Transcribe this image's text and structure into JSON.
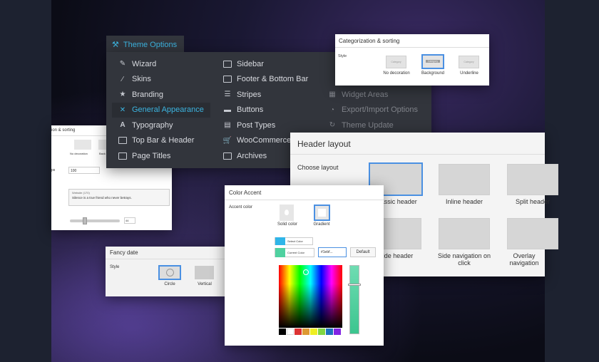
{
  "theme_menu": {
    "tab_label": "Theme Options",
    "col1": [
      {
        "label": "Wizard",
        "icon": "wand-icon"
      },
      {
        "label": "Skins",
        "icon": "brush-icon"
      },
      {
        "label": "Branding",
        "icon": "star-icon"
      },
      {
        "label": "General Appearance",
        "icon": "tools-icon",
        "active": true
      },
      {
        "label": "Typography",
        "icon": "font-icon"
      },
      {
        "label": "Top Bar & Header",
        "icon": "header-layout-icon"
      },
      {
        "label": "Page Titles",
        "icon": "page-icon"
      }
    ],
    "col2": [
      {
        "label": "Sidebar",
        "icon": "sidebar-icon"
      },
      {
        "label": "Footer & Bottom Bar",
        "icon": "footer-icon"
      },
      {
        "label": "Stripes",
        "icon": "stripes-icon"
      },
      {
        "label": "Buttons",
        "icon": "button-icon"
      },
      {
        "label": "Post Types",
        "icon": "post-types-icon"
      },
      {
        "label": "WooCommerce",
        "icon": "cart-icon"
      },
      {
        "label": "Archives",
        "icon": "archive-icon"
      }
    ],
    "col3": [
      {
        "label": "Widget Areas",
        "icon": "widgets-icon"
      },
      {
        "label": "Export/Import Options",
        "icon": "export-icon"
      },
      {
        "label": "Theme Update",
        "icon": "refresh-icon"
      }
    ]
  },
  "categorization": {
    "title": "Categorization & sorting",
    "style_label": "Style",
    "options": [
      {
        "thumb": "Category",
        "caption": "No decoration"
      },
      {
        "thumb": "Category",
        "caption": "Background",
        "selected": true
      },
      {
        "thumb": "Category",
        "caption": "Underline"
      }
    ]
  },
  "left_panel": {
    "title": "ion & sorting",
    "opt1": "No decoration",
    "opt2": "Back",
    "row_label": "ps",
    "value": "100",
    "text_hint": "Website (170)",
    "text_body": "Silence is a true friend who never betrays.",
    "slider_value": "44"
  },
  "header_layout": {
    "title": "Header layout",
    "choose_label": "Choose layout",
    "layouts": [
      {
        "caption": "Classic header",
        "selected": true
      },
      {
        "caption": "Inline header"
      },
      {
        "caption": "Split header"
      },
      {
        "caption": "Side header"
      },
      {
        "caption": "Side navigation on click"
      },
      {
        "caption": "Overlay navigation"
      }
    ]
  },
  "fancy_date": {
    "title": "Fancy date",
    "style_label": "Style",
    "options": [
      {
        "caption": "Circle",
        "selected": true
      },
      {
        "caption": "Vertical"
      }
    ]
  },
  "color_accent": {
    "title": "Color Accent",
    "accent_label": "Accent color",
    "solid_label": "Solid color",
    "gradient_label": "Gradient",
    "select_color_label": "Select Color",
    "current_color_label": "Current Color",
    "hex_value": "#1ebf...",
    "default_button": "Default",
    "colors": {
      "select": "#2fb5e8",
      "current": "#4fd1a0"
    },
    "swatches": [
      "#000000",
      "#ffffff",
      "#dd3333",
      "#dd9933",
      "#eeee22",
      "#81d742",
      "#1e73be",
      "#8224e3"
    ]
  }
}
